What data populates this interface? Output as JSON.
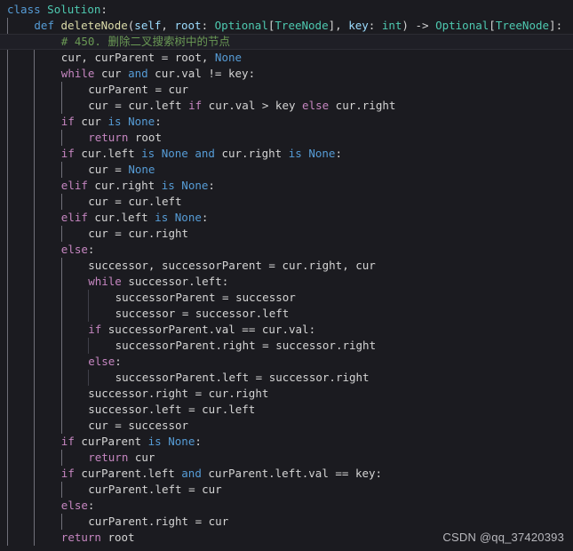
{
  "editor": {
    "language": "python",
    "theme": "dark-plus",
    "background_color": "#1b1b20",
    "active_line_color": "#1f1f26",
    "default_text_color": "#d4d4d4",
    "active_line_number": 3,
    "indent_guide_color": "#404049",
    "indent_guide_active_color": "#707079",
    "colors": {
      "keyword": "#569cd6",
      "control": "#c586c0",
      "type": "#4ec9b0",
      "function": "#dcdcaa",
      "parameter": "#9cdcfe",
      "constant": "#569cd6",
      "comment": "#6a9955",
      "plain": "#d4d4d4"
    }
  },
  "watermark": {
    "text": "CSDN @qq_37420393"
  },
  "code": {
    "lines": [
      {
        "indent": 0,
        "tokens": [
          {
            "t": "class",
            "c": "t-kw"
          },
          {
            "t": " ",
            "c": "t-plain"
          },
          {
            "t": "Solution",
            "c": "t-type"
          },
          {
            "t": ":",
            "c": "t-punct"
          }
        ]
      },
      {
        "indent": 1,
        "tokens": [
          {
            "t": "def",
            "c": "t-kw"
          },
          {
            "t": " ",
            "c": "t-plain"
          },
          {
            "t": "deleteNode",
            "c": "t-func"
          },
          {
            "t": "(",
            "c": "t-punct"
          },
          {
            "t": "self",
            "c": "t-param"
          },
          {
            "t": ", ",
            "c": "t-punct"
          },
          {
            "t": "root",
            "c": "t-param"
          },
          {
            "t": ": ",
            "c": "t-punct"
          },
          {
            "t": "Optional",
            "c": "t-type"
          },
          {
            "t": "[",
            "c": "t-punct"
          },
          {
            "t": "TreeNode",
            "c": "t-type"
          },
          {
            "t": "]",
            "c": "t-punct"
          },
          {
            "t": ", ",
            "c": "t-punct"
          },
          {
            "t": "key",
            "c": "t-param"
          },
          {
            "t": ": ",
            "c": "t-punct"
          },
          {
            "t": "int",
            "c": "t-type"
          },
          {
            "t": ")",
            "c": "t-punct"
          },
          {
            "t": " -> ",
            "c": "t-op"
          },
          {
            "t": "Optional",
            "c": "t-type"
          },
          {
            "t": "[",
            "c": "t-punct"
          },
          {
            "t": "TreeNode",
            "c": "t-type"
          },
          {
            "t": "]",
            "c": "t-punct"
          },
          {
            "t": ":",
            "c": "t-punct"
          }
        ]
      },
      {
        "indent": 2,
        "active": true,
        "tokens": [
          {
            "t": "# 450. 删除二叉搜索树中的节点",
            "c": "t-comment"
          }
        ]
      },
      {
        "indent": 2,
        "tokens": [
          {
            "t": "cur",
            "c": "t-plain"
          },
          {
            "t": ", ",
            "c": "t-punct"
          },
          {
            "t": "curParent",
            "c": "t-plain"
          },
          {
            "t": " = ",
            "c": "t-op"
          },
          {
            "t": "root",
            "c": "t-plain"
          },
          {
            "t": ", ",
            "c": "t-punct"
          },
          {
            "t": "None",
            "c": "t-const"
          }
        ]
      },
      {
        "indent": 2,
        "tokens": [
          {
            "t": "while",
            "c": "t-ctrl"
          },
          {
            "t": " cur ",
            "c": "t-plain"
          },
          {
            "t": "and",
            "c": "t-kw"
          },
          {
            "t": " cur.val ",
            "c": "t-plain"
          },
          {
            "t": "!=",
            "c": "t-op"
          },
          {
            "t": " key",
            "c": "t-plain"
          },
          {
            "t": ":",
            "c": "t-punct"
          }
        ]
      },
      {
        "indent": 3,
        "tokens": [
          {
            "t": "curParent",
            "c": "t-plain"
          },
          {
            "t": " = ",
            "c": "t-op"
          },
          {
            "t": "cur",
            "c": "t-plain"
          }
        ]
      },
      {
        "indent": 3,
        "tokens": [
          {
            "t": "cur",
            "c": "t-plain"
          },
          {
            "t": " = ",
            "c": "t-op"
          },
          {
            "t": "cur.left ",
            "c": "t-plain"
          },
          {
            "t": "if",
            "c": "t-ctrl"
          },
          {
            "t": " cur.val ",
            "c": "t-plain"
          },
          {
            "t": ">",
            "c": "t-op"
          },
          {
            "t": " key ",
            "c": "t-plain"
          },
          {
            "t": "else",
            "c": "t-ctrl"
          },
          {
            "t": " cur.right",
            "c": "t-plain"
          }
        ]
      },
      {
        "indent": 2,
        "tokens": [
          {
            "t": "if",
            "c": "t-ctrl"
          },
          {
            "t": " cur ",
            "c": "t-plain"
          },
          {
            "t": "is",
            "c": "t-kw"
          },
          {
            "t": " ",
            "c": "t-plain"
          },
          {
            "t": "None",
            "c": "t-const"
          },
          {
            "t": ":",
            "c": "t-punct"
          }
        ]
      },
      {
        "indent": 3,
        "tokens": [
          {
            "t": "return",
            "c": "t-ctrl"
          },
          {
            "t": " root",
            "c": "t-plain"
          }
        ]
      },
      {
        "indent": 2,
        "tokens": [
          {
            "t": "if",
            "c": "t-ctrl"
          },
          {
            "t": " cur.left ",
            "c": "t-plain"
          },
          {
            "t": "is",
            "c": "t-kw"
          },
          {
            "t": " ",
            "c": "t-plain"
          },
          {
            "t": "None",
            "c": "t-const"
          },
          {
            "t": " ",
            "c": "t-plain"
          },
          {
            "t": "and",
            "c": "t-kw"
          },
          {
            "t": " cur.right ",
            "c": "t-plain"
          },
          {
            "t": "is",
            "c": "t-kw"
          },
          {
            "t": " ",
            "c": "t-plain"
          },
          {
            "t": "None",
            "c": "t-const"
          },
          {
            "t": ":",
            "c": "t-punct"
          }
        ]
      },
      {
        "indent": 3,
        "tokens": [
          {
            "t": "cur",
            "c": "t-plain"
          },
          {
            "t": " = ",
            "c": "t-op"
          },
          {
            "t": "None",
            "c": "t-const"
          }
        ]
      },
      {
        "indent": 2,
        "tokens": [
          {
            "t": "elif",
            "c": "t-ctrl"
          },
          {
            "t": " cur.right ",
            "c": "t-plain"
          },
          {
            "t": "is",
            "c": "t-kw"
          },
          {
            "t": " ",
            "c": "t-plain"
          },
          {
            "t": "None",
            "c": "t-const"
          },
          {
            "t": ":",
            "c": "t-punct"
          }
        ]
      },
      {
        "indent": 3,
        "tokens": [
          {
            "t": "cur",
            "c": "t-plain"
          },
          {
            "t": " = ",
            "c": "t-op"
          },
          {
            "t": "cur.left",
            "c": "t-plain"
          }
        ]
      },
      {
        "indent": 2,
        "tokens": [
          {
            "t": "elif",
            "c": "t-ctrl"
          },
          {
            "t": " cur.left ",
            "c": "t-plain"
          },
          {
            "t": "is",
            "c": "t-kw"
          },
          {
            "t": " ",
            "c": "t-plain"
          },
          {
            "t": "None",
            "c": "t-const"
          },
          {
            "t": ":",
            "c": "t-punct"
          }
        ]
      },
      {
        "indent": 3,
        "tokens": [
          {
            "t": "cur",
            "c": "t-plain"
          },
          {
            "t": " = ",
            "c": "t-op"
          },
          {
            "t": "cur.right",
            "c": "t-plain"
          }
        ]
      },
      {
        "indent": 2,
        "tokens": [
          {
            "t": "else",
            "c": "t-ctrl"
          },
          {
            "t": ":",
            "c": "t-punct"
          }
        ]
      },
      {
        "indent": 3,
        "tokens": [
          {
            "t": "successor",
            "c": "t-plain"
          },
          {
            "t": ", ",
            "c": "t-punct"
          },
          {
            "t": "successorParent",
            "c": "t-plain"
          },
          {
            "t": " = ",
            "c": "t-op"
          },
          {
            "t": "cur.right",
            "c": "t-plain"
          },
          {
            "t": ", ",
            "c": "t-punct"
          },
          {
            "t": "cur",
            "c": "t-plain"
          }
        ]
      },
      {
        "indent": 3,
        "tokens": [
          {
            "t": "while",
            "c": "t-ctrl"
          },
          {
            "t": " successor.left",
            "c": "t-plain"
          },
          {
            "t": ":",
            "c": "t-punct"
          }
        ]
      },
      {
        "indent": 4,
        "tokens": [
          {
            "t": "successorParent",
            "c": "t-plain"
          },
          {
            "t": " = ",
            "c": "t-op"
          },
          {
            "t": "successor",
            "c": "t-plain"
          }
        ]
      },
      {
        "indent": 4,
        "tokens": [
          {
            "t": "successor",
            "c": "t-plain"
          },
          {
            "t": " = ",
            "c": "t-op"
          },
          {
            "t": "successor.left",
            "c": "t-plain"
          }
        ]
      },
      {
        "indent": 3,
        "tokens": [
          {
            "t": "if",
            "c": "t-ctrl"
          },
          {
            "t": " successorParent.val ",
            "c": "t-plain"
          },
          {
            "t": "==",
            "c": "t-op"
          },
          {
            "t": " cur.val",
            "c": "t-plain"
          },
          {
            "t": ":",
            "c": "t-punct"
          }
        ]
      },
      {
        "indent": 4,
        "tokens": [
          {
            "t": "successorParent.right",
            "c": "t-plain"
          },
          {
            "t": " = ",
            "c": "t-op"
          },
          {
            "t": "successor.right",
            "c": "t-plain"
          }
        ]
      },
      {
        "indent": 3,
        "tokens": [
          {
            "t": "else",
            "c": "t-ctrl"
          },
          {
            "t": ":",
            "c": "t-punct"
          }
        ]
      },
      {
        "indent": 4,
        "tokens": [
          {
            "t": "successorParent.left",
            "c": "t-plain"
          },
          {
            "t": " = ",
            "c": "t-op"
          },
          {
            "t": "successor.right",
            "c": "t-plain"
          }
        ]
      },
      {
        "indent": 3,
        "tokens": [
          {
            "t": "successor.right",
            "c": "t-plain"
          },
          {
            "t": " = ",
            "c": "t-op"
          },
          {
            "t": "cur.right",
            "c": "t-plain"
          }
        ]
      },
      {
        "indent": 3,
        "tokens": [
          {
            "t": "successor.left",
            "c": "t-plain"
          },
          {
            "t": " = ",
            "c": "t-op"
          },
          {
            "t": "cur.left",
            "c": "t-plain"
          }
        ]
      },
      {
        "indent": 3,
        "tokens": [
          {
            "t": "cur",
            "c": "t-plain"
          },
          {
            "t": " = ",
            "c": "t-op"
          },
          {
            "t": "successor",
            "c": "t-plain"
          }
        ]
      },
      {
        "indent": 2,
        "tokens": [
          {
            "t": "if",
            "c": "t-ctrl"
          },
          {
            "t": " curParent ",
            "c": "t-plain"
          },
          {
            "t": "is",
            "c": "t-kw"
          },
          {
            "t": " ",
            "c": "t-plain"
          },
          {
            "t": "None",
            "c": "t-const"
          },
          {
            "t": ":",
            "c": "t-punct"
          }
        ]
      },
      {
        "indent": 3,
        "tokens": [
          {
            "t": "return",
            "c": "t-ctrl"
          },
          {
            "t": " cur",
            "c": "t-plain"
          }
        ]
      },
      {
        "indent": 2,
        "tokens": [
          {
            "t": "if",
            "c": "t-ctrl"
          },
          {
            "t": " curParent.left ",
            "c": "t-plain"
          },
          {
            "t": "and",
            "c": "t-kw"
          },
          {
            "t": " curParent.left.val ",
            "c": "t-plain"
          },
          {
            "t": "==",
            "c": "t-op"
          },
          {
            "t": " key",
            "c": "t-plain"
          },
          {
            "t": ":",
            "c": "t-punct"
          }
        ]
      },
      {
        "indent": 3,
        "tokens": [
          {
            "t": "curParent.left",
            "c": "t-plain"
          },
          {
            "t": " = ",
            "c": "t-op"
          },
          {
            "t": "cur",
            "c": "t-plain"
          }
        ]
      },
      {
        "indent": 2,
        "tokens": [
          {
            "t": "else",
            "c": "t-ctrl"
          },
          {
            "t": ":",
            "c": "t-punct"
          }
        ]
      },
      {
        "indent": 3,
        "tokens": [
          {
            "t": "curParent.right",
            "c": "t-plain"
          },
          {
            "t": " = ",
            "c": "t-op"
          },
          {
            "t": "cur",
            "c": "t-plain"
          }
        ]
      },
      {
        "indent": 2,
        "tokens": [
          {
            "t": "return",
            "c": "t-ctrl"
          },
          {
            "t": " root",
            "c": "t-plain"
          }
        ]
      }
    ]
  }
}
